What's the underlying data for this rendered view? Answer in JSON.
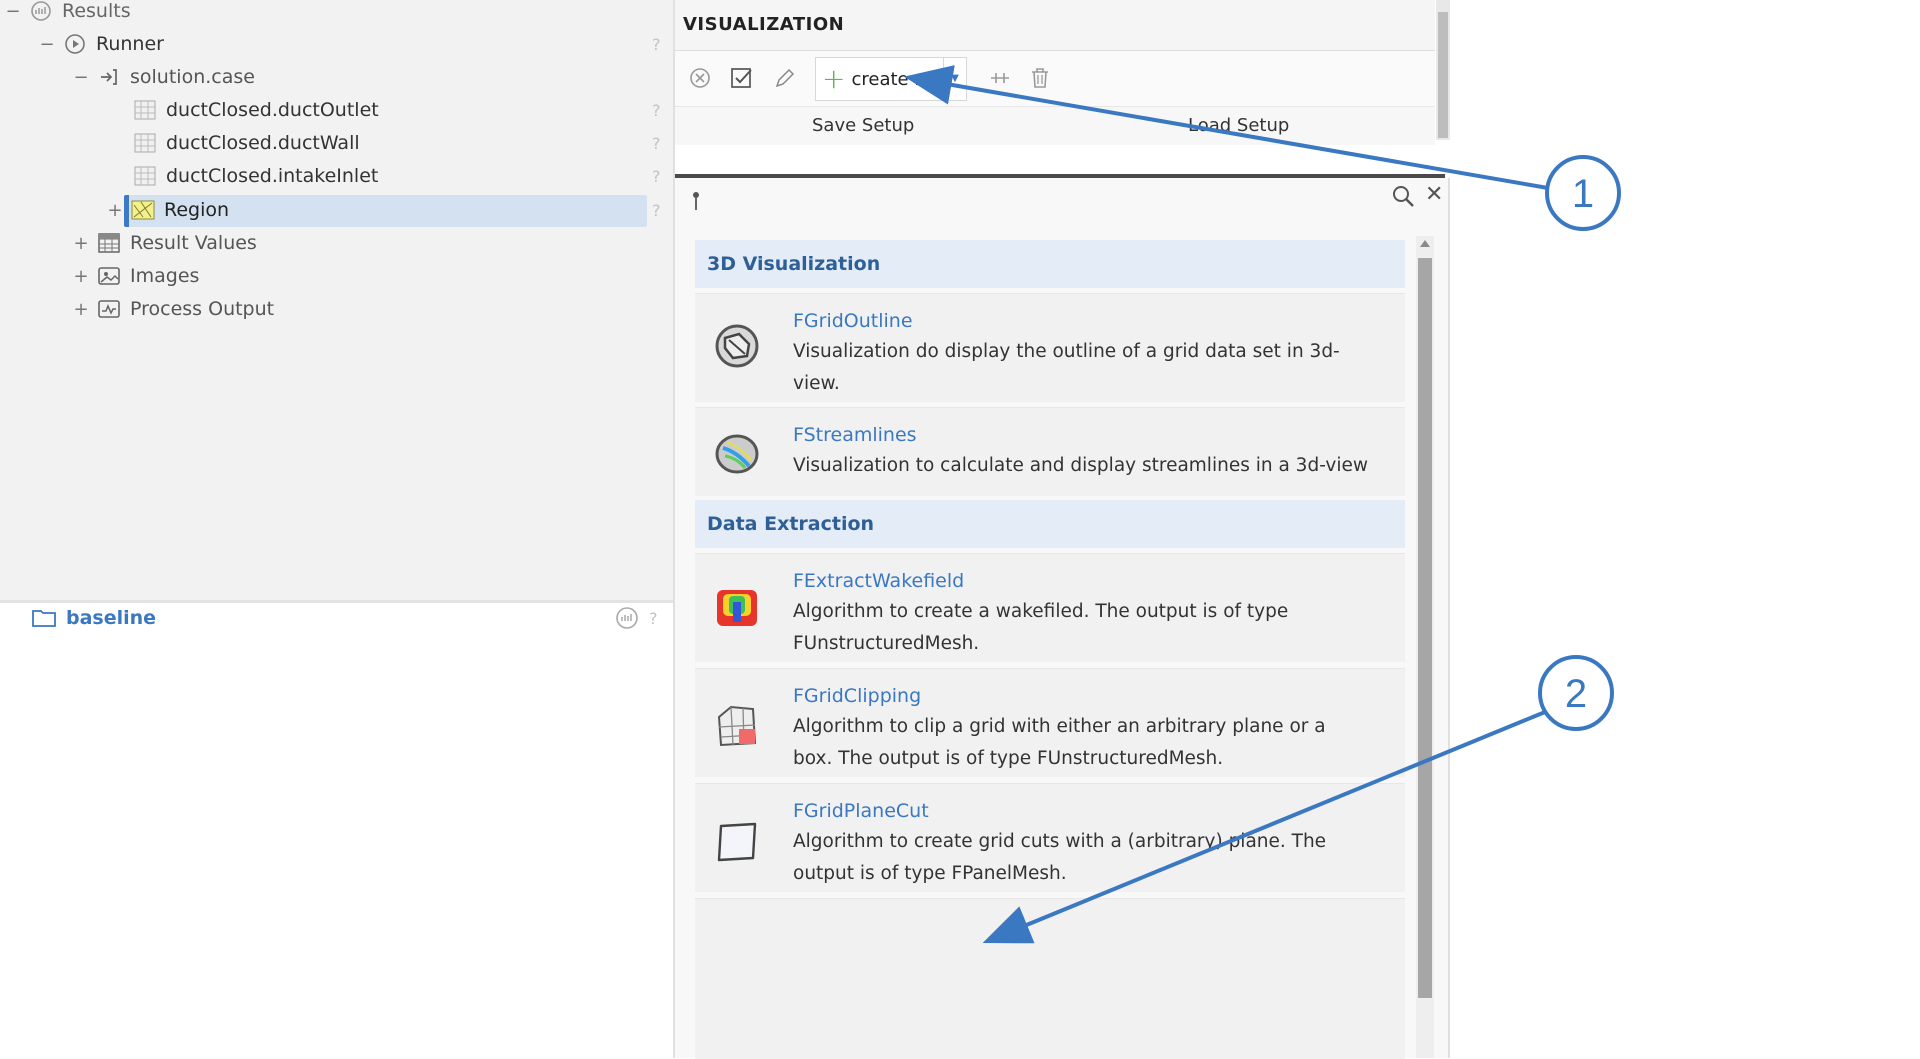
{
  "tree": {
    "results_label": "Results",
    "runner_label": "Runner",
    "solution_label": "solution.case",
    "outlet_label": "ductClosed.ductOutlet",
    "wall_label": "ductClosed.ductWall",
    "inlet_label": "ductClosed.intakeInlet",
    "region_label": "Region",
    "result_values_label": "Result Values",
    "images_label": "Images",
    "process_output_label": "Process Output",
    "help_mark": "?",
    "baseline_label": "baseline"
  },
  "visualization": {
    "title": "VISUALIZATION",
    "create_label": "create new",
    "save_setup": "Save Setup",
    "load_setup": "Load Setup"
  },
  "catalog": {
    "sections": [
      {
        "title": "3D Visualization"
      },
      {
        "title": "Data Extraction"
      }
    ],
    "items": [
      {
        "name": "FGridOutline",
        "desc": "Visualization do display the outline of a grid data set in 3d-view.",
        "icon": "grid-outline-icon"
      },
      {
        "name": "FStreamlines",
        "desc": "Visualization to calculate and display streamlines in a 3d-view",
        "icon": "streamlines-icon"
      },
      {
        "name": "FExtractWakefield",
        "desc": "Algorithm to create a wakefiled. The output is of type FUnstructuredMesh.",
        "icon": "wakefield-icon"
      },
      {
        "name": "FGridClipping",
        "desc": "Algorithm to clip a grid with either an arbitrary plane or a box. The output is of type FUnstructuredMesh.",
        "icon": "grid-clipping-icon"
      },
      {
        "name": "FGridPlaneCut",
        "desc": "Algorithm to create grid cuts with a (arbitrary) plane. The output is of type FPanelMesh.",
        "icon": "plane-cut-icon"
      }
    ]
  },
  "callouts": {
    "one": "1",
    "two": "2"
  },
  "colors": {
    "accent": "#3a78c2",
    "selection": "#d4e1f0",
    "section_bg": "#e3ecf7",
    "add_green": "#58b848"
  }
}
